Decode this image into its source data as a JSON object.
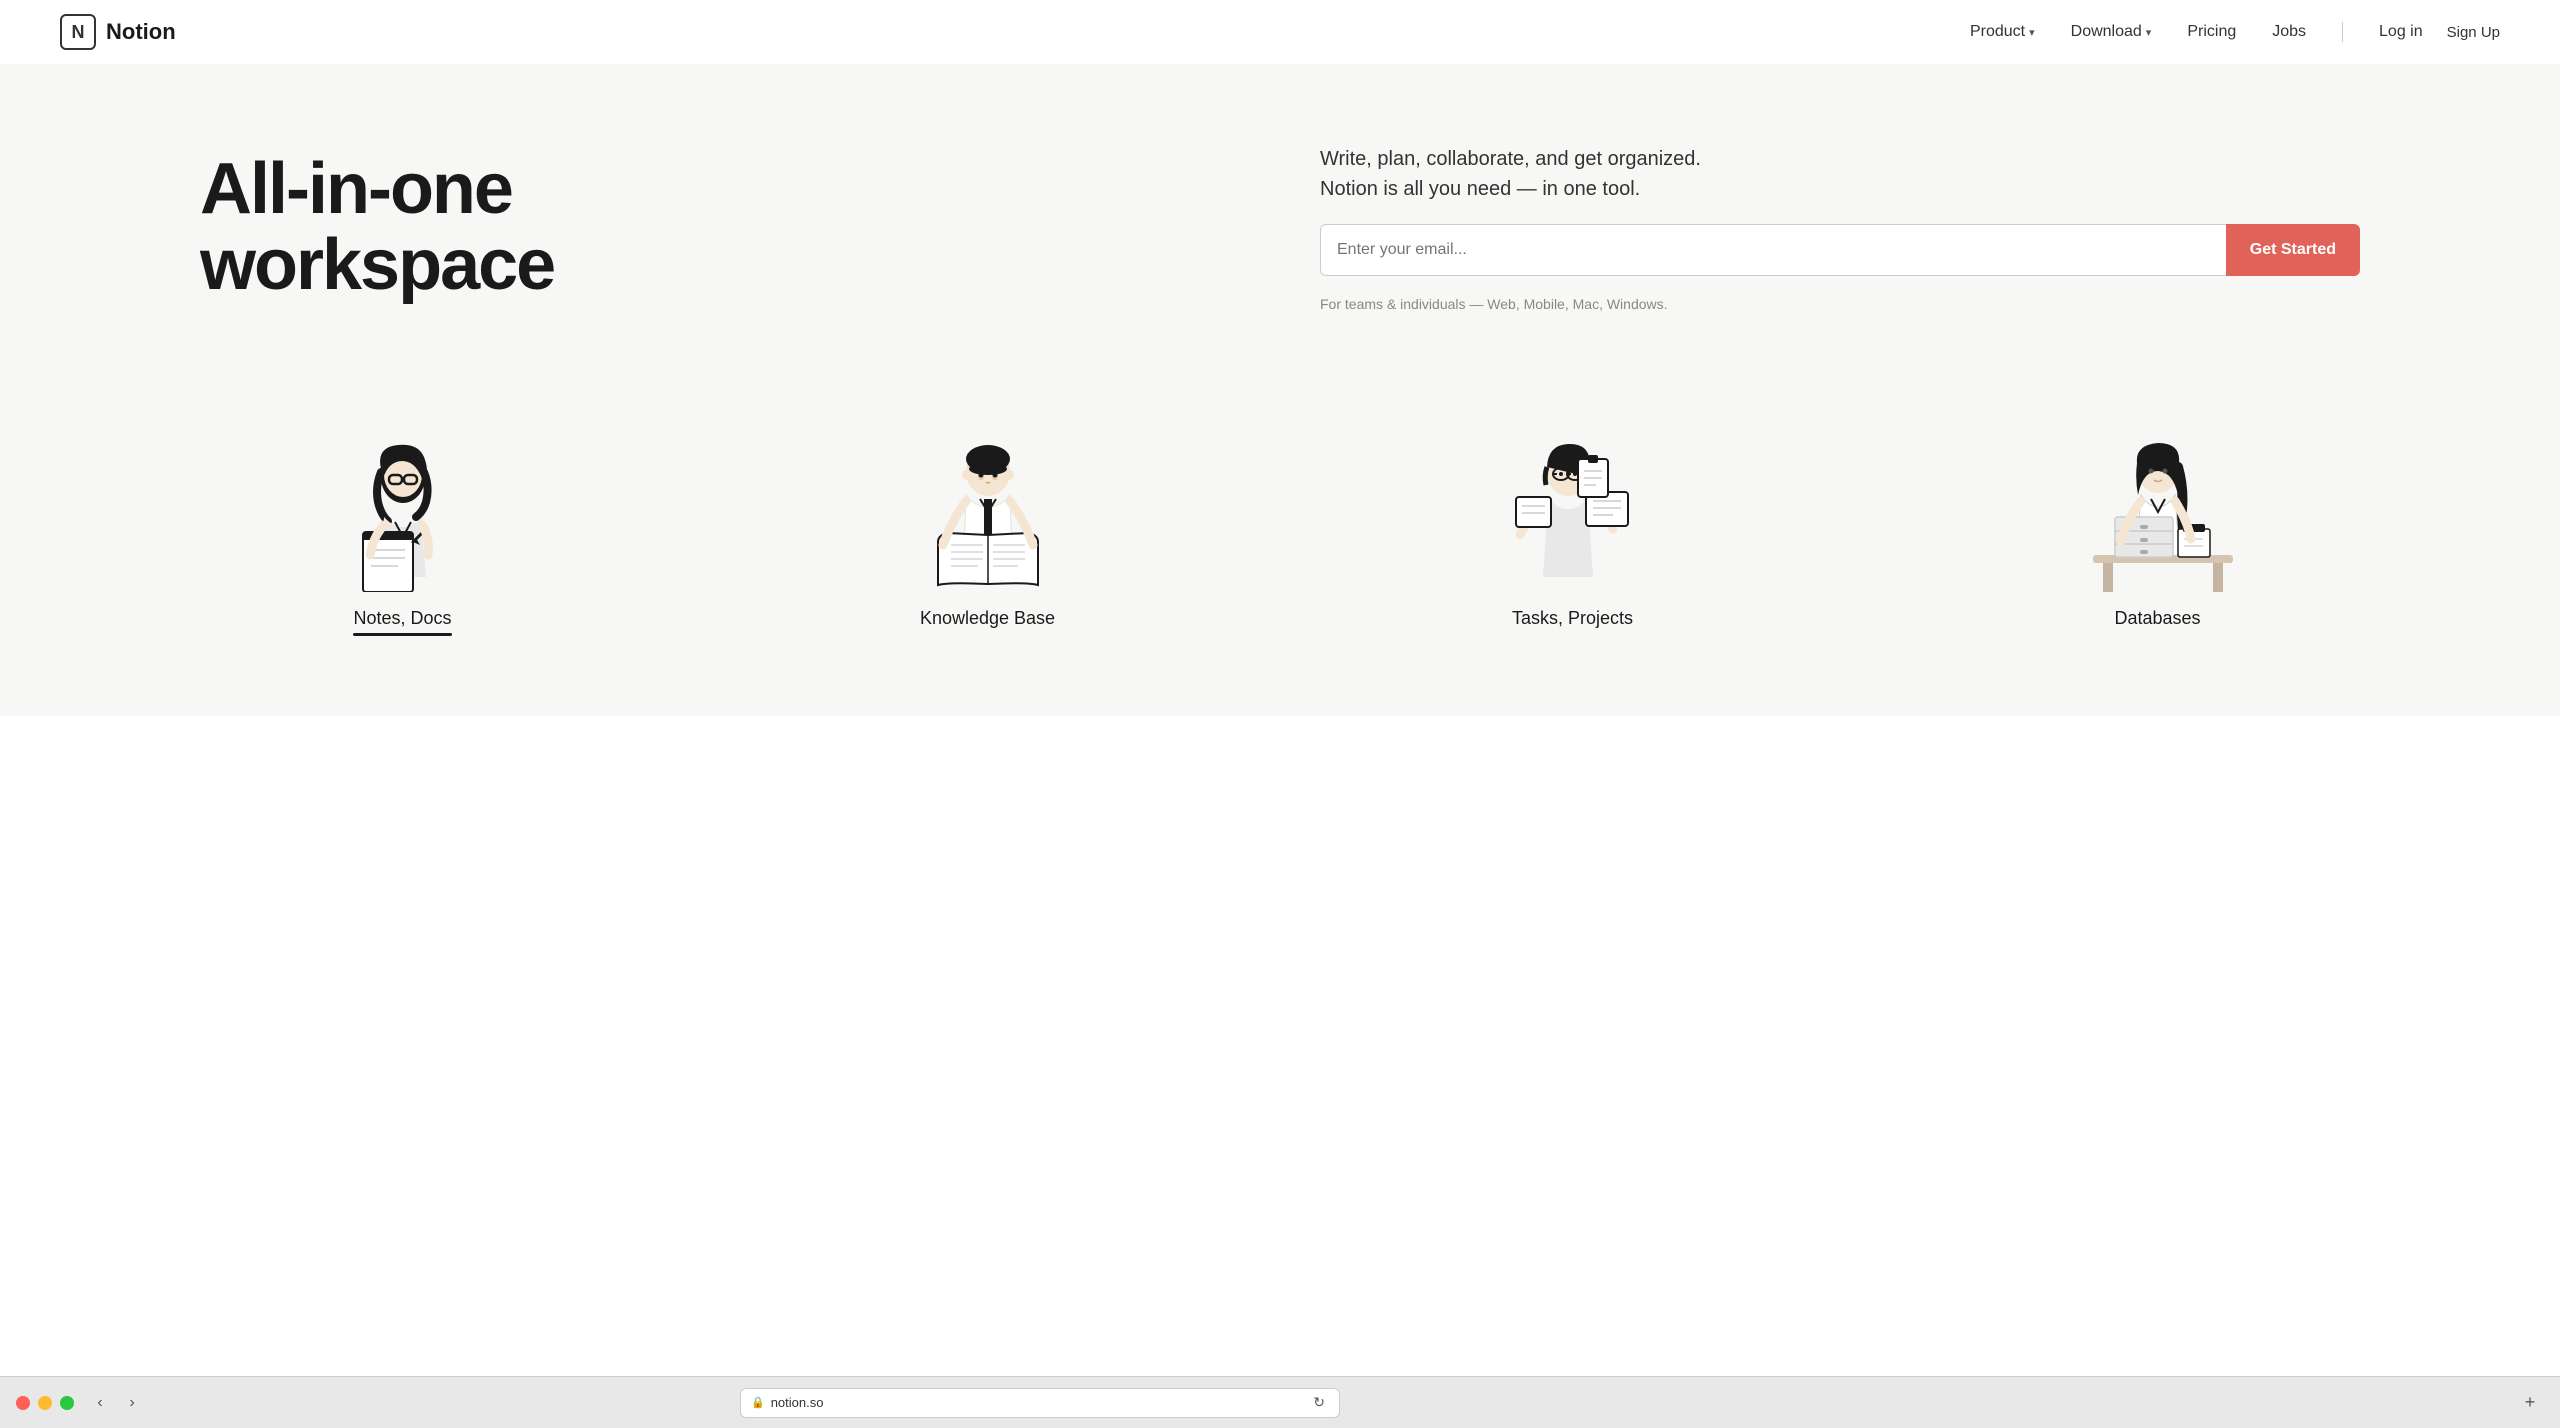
{
  "navbar": {
    "brand": "Notion",
    "links": [
      {
        "label": "Product",
        "hasDropdown": true
      },
      {
        "label": "Download",
        "hasDropdown": true
      },
      {
        "label": "Pricing",
        "hasDropdown": false
      },
      {
        "label": "Jobs",
        "hasDropdown": false
      }
    ],
    "auth": {
      "login": "Log in",
      "signup": "Sign Up"
    }
  },
  "hero": {
    "title_line1": "All-in-one",
    "title_line2": "workspace",
    "tagline_line1": "Write, plan, collaborate, and get organized.",
    "tagline_line2": "Notion is all you need — in one tool.",
    "email_placeholder": "Enter your email...",
    "cta_button": "Get Started",
    "sub_text": "For teams & individuals — Web, Mobile, Mac, Windows."
  },
  "features": [
    {
      "label": "Notes, Docs",
      "underlined": true
    },
    {
      "label": "Knowledge Base",
      "underlined": false
    },
    {
      "label": "Tasks, Projects",
      "underlined": false
    },
    {
      "label": "Databases",
      "underlined": false
    }
  ],
  "browser": {
    "url": "notion.so",
    "back_label": "‹",
    "forward_label": "›",
    "refresh_label": "↻"
  },
  "colors": {
    "cta": "#e16259",
    "brand": "#1a1a1a",
    "bg": "#f7f7f5"
  }
}
